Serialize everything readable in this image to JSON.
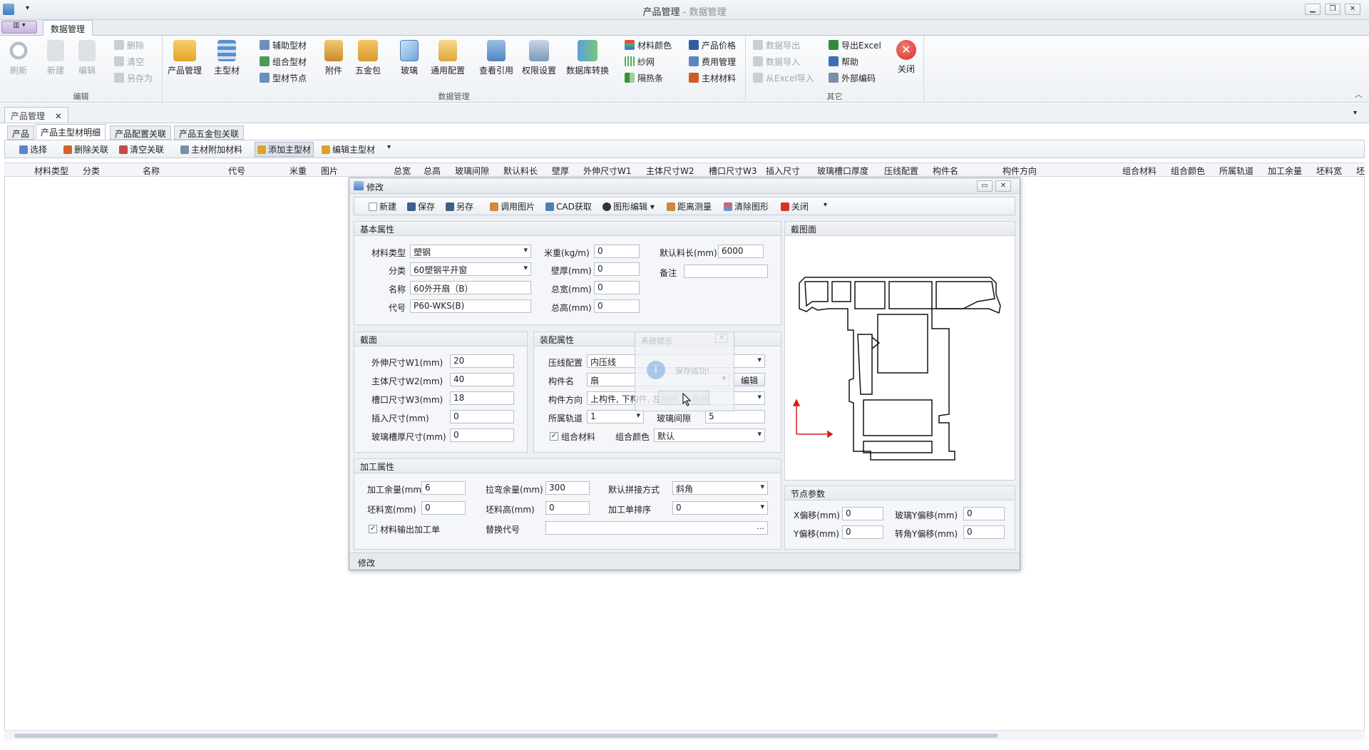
{
  "window": {
    "title": "产品管理",
    "subtitle": " - 数据管理"
  },
  "ribbon": {
    "tab": "数据管理",
    "groups": {
      "edit": "编辑",
      "data": "数据管理",
      "other": "其它"
    },
    "edit": {
      "refresh": "刷新",
      "new": "新建",
      "edit": "编辑",
      "delete": "删除",
      "clear": "清空",
      "save_as": "另存为"
    },
    "data": {
      "product_mgmt": "产品管理",
      "main_profile": "主型材",
      "aux_profile": "辅助型材",
      "combo_profile": "组合型材",
      "profile_node": "型材节点",
      "accessory": "附件",
      "hardware": "五金包",
      "glass": "玻璃",
      "common_config": "通用配置",
      "view_ref": "查看引用",
      "permission": "权限设置",
      "db_convert": "数据库转换",
      "material_color": "材料颜色",
      "screen": "纱网",
      "thermal_strip": "隔热条",
      "product_price": "产品价格",
      "fee_mgmt": "费用管理",
      "main_material": "主材材料"
    },
    "other": {
      "export_data": "数据导出",
      "import_data": "数据导入",
      "import_excel": "从Excel导入",
      "export_excel": "导出Excel",
      "help": "帮助",
      "ext_code": "外部编码",
      "close": "关闭"
    }
  },
  "doc_tab": "产品管理",
  "inner_tabs": [
    "产品",
    "产品主型材明细",
    "产品配置关联",
    "产品五金包关联"
  ],
  "toolbar": {
    "select": "选择",
    "del_link": "删除关联",
    "clear_link": "清空关联",
    "main_extra": "主材附加材料",
    "add_main": "添加主型材",
    "edit_main": "编辑主型材"
  },
  "grid_columns": [
    "材料类型",
    "分类",
    "名称",
    "代号",
    "米重",
    "图片",
    "总宽",
    "总高",
    "玻璃间隙",
    "默认料长",
    "壁厚",
    "外伸尺寸W1",
    "主体尺寸W2",
    "槽口尺寸W3",
    "插入尺寸",
    "玻璃槽口厚度",
    "压线配置",
    "构件名",
    "构件方向",
    "组合材料",
    "组合颜色",
    "所属轨道",
    "加工余量",
    "坯料宽",
    "坯"
  ],
  "dialog": {
    "title": "修改",
    "toolbar": {
      "new": "新建",
      "save": "保存",
      "save_as": "另存",
      "call_image": "调用图片",
      "cad": "CAD获取",
      "shape_edit": "图形编辑",
      "measure": "距离测量",
      "clear_shape": "清除图形",
      "close": "关闭"
    },
    "basic": {
      "title": "基本属性",
      "material_type_label": "材料类型",
      "material_type": "塑钢",
      "category_label": "分类",
      "category": "60塑钢平开窗",
      "name_label": "名称",
      "name": "60外开扇（B）",
      "code_label": "代号",
      "code": "P60-WKS(B)",
      "meter_weight_label": "米重(kg/m)",
      "meter_weight": "0",
      "wall_label": "壁厚(mm)",
      "wall": "0",
      "total_width_label": "总宽(mm)",
      "total_width": "0",
      "total_height_label": "总高(mm)",
      "total_height": "0",
      "default_len_label": "默认料长(mm)",
      "default_len": "6000",
      "remark_label": "备注",
      "remark": ""
    },
    "section": {
      "title": "截面",
      "w1_label": "外伸尺寸W1(mm)",
      "w1": "20",
      "w2_label": "主体尺寸W2(mm)",
      "w2": "40",
      "w3_label": "槽口尺寸W3(mm)",
      "w3": "18",
      "insert_label": "插入尺寸(mm)",
      "insert": "0",
      "glass_groove_label": "玻璃槽厚尺寸(mm)",
      "glass_groove": "0"
    },
    "assembly": {
      "title": "装配属性",
      "bead_label": "压线配置",
      "bead": "内压线",
      "part_label": "构件名",
      "part": "扇",
      "edit_btn": "编辑",
      "direction_label": "构件方向",
      "direction": "上构件, 下构件, 左构件, 右构件",
      "track_label": "所属轨道",
      "track": "1",
      "glass_gap_label": "玻璃间隙",
      "glass_gap": "5",
      "combo_material_label": "组合材料",
      "combo_material_checked": true,
      "combo_color_label": "组合颜色",
      "combo_color": "默认"
    },
    "processing": {
      "title": "加工属性",
      "allowance_label": "加工余量(mm)",
      "allowance": "6",
      "bend_label": "拉弯余量(mm)",
      "bend": "300",
      "joint_label": "默认拼接方式",
      "joint": "斜角",
      "blank_w_label": "坯料宽(mm)",
      "blank_w": "0",
      "blank_h_label": "坯料高(mm)",
      "blank_h": "0",
      "sort_label": "加工单排序",
      "sort": "0",
      "output_label": "材料输出加工单",
      "output_checked": true,
      "replace_label": "替换代号",
      "replace": ""
    },
    "profile_view": {
      "title": "截图面"
    },
    "node": {
      "title": "节点参数",
      "x_label": "X偏移(mm)",
      "x": "0",
      "y_label": "Y偏移(mm)",
      "y": "0",
      "glass_y_label": "玻璃Y偏移(mm)",
      "glass_y": "0",
      "corner_y_label": "转角Y偏移(mm)",
      "corner_y": "0"
    },
    "status": "修改"
  },
  "toast": {
    "title": "系统提示",
    "message": "保存成功!"
  },
  "colors": {
    "accent": "#2b579a",
    "close_red": "#d9302a",
    "axis_red": "#d42020"
  }
}
